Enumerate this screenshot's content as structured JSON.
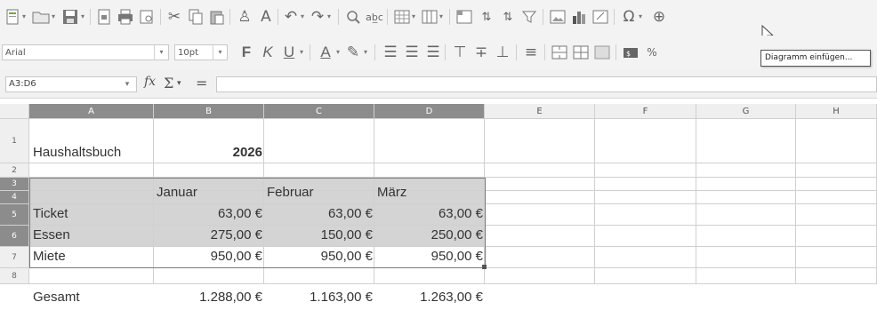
{
  "toolbar1": {
    "icons": [
      "new-document-icon",
      "open-folder-icon",
      "save-icon",
      "export-pdf-icon",
      "print-icon",
      "print-preview-icon",
      "cut-icon",
      "copy-icon",
      "paste-icon",
      "clone-formatting-icon",
      "clear-formatting-icon",
      "undo-icon",
      "redo-icon",
      "find-replace-icon",
      "spelling-icon",
      "row-icon",
      "column-icon",
      "freeze-icon",
      "sort-ascending-icon",
      "sort-descending-icon",
      "autofilter-icon",
      "insert-image-icon",
      "insert-chart-icon",
      "pivot-table-icon",
      "special-character-icon",
      "hyperlink-icon"
    ]
  },
  "toolbar2": {
    "font_name": "Arial",
    "font_size": "10pt",
    "bold": "F",
    "italic": "K",
    "underline": "U",
    "font_color": "A"
  },
  "formula_bar": {
    "name_box": "A3:D6",
    "fx_label": "fx",
    "sum_label": "Σ",
    "equals_label": "=",
    "content": ""
  },
  "tooltip": {
    "text": "Diagramm einfügen..."
  },
  "columns": [
    "A",
    "B",
    "C",
    "D",
    "E",
    "F",
    "G",
    "H"
  ],
  "rows": [
    "1",
    "2",
    "3",
    "4",
    "5",
    "6",
    "7",
    "8"
  ],
  "cells": {
    "A1": "Haushaltsbuch",
    "B1": "2026",
    "B3": "Januar",
    "C3": "Februar",
    "D3": "März",
    "A4": "Ticket",
    "B4": "63,00 €",
    "C4": "63,00 €",
    "D4": "63,00 €",
    "A5": "Essen",
    "B5": "275,00 €",
    "C5": "150,00 €",
    "D5": "250,00 €",
    "A6": "Miete",
    "B6": "950,00 €",
    "C6": "950,00 €",
    "D6": "950,00 €",
    "A8": "Gesamt",
    "B8": "1.288,00 €",
    "C8": "1.163,00 €",
    "D8": "1.263,00 €"
  },
  "colors": {
    "selected_header": "#8c8c8c",
    "selected_range": "#d4d4d4",
    "header_bg": "#efefef",
    "gridline": "#d0d0d0"
  }
}
